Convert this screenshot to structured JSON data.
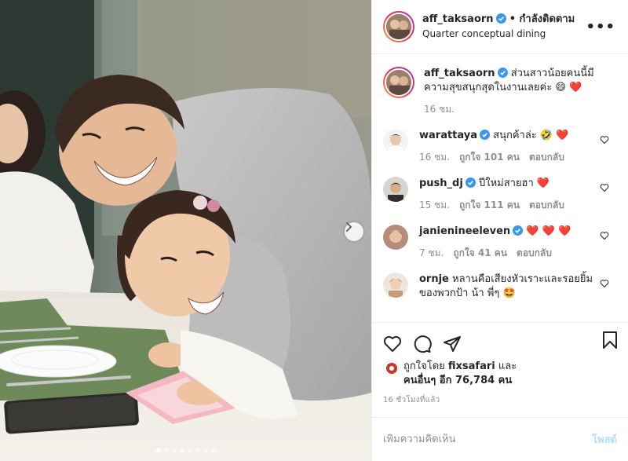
{
  "header": {
    "username": "aff_taksaorn",
    "follow_status": "• กำลังติดตาม",
    "location": "Quarter conceptual dining",
    "more_label": "•••"
  },
  "caption": {
    "username": "aff_taksaorn",
    "text": "ส่วนสาวน้อยคนนี้มีความสุขสนุกสุดในงานเลยค่ะ 😄 ❤️",
    "time": "16 ชม."
  },
  "comments": [
    {
      "username": "warattaya",
      "verified": true,
      "text": "สนุกค้าล่ะ 🤣 ❤️",
      "time": "16 ชม.",
      "likes": "ถูกใจ 101 คน",
      "reply": "ตอบกลับ"
    },
    {
      "username": "push_dj",
      "verified": true,
      "text": "ปีใหม่สายฮา ❤️",
      "time": "15 ชม.",
      "likes": "ถูกใจ 111 คน",
      "reply": "ตอบกลับ"
    },
    {
      "username": "janienineeleven",
      "verified": true,
      "text": "❤️ ❤️ ❤️",
      "time": "7 ชม.",
      "likes": "ถูกใจ 41 คน",
      "reply": "ตอบกลับ"
    },
    {
      "username": "ornje",
      "verified": false,
      "text": "หลานคือเสียงหัวเราะและรอยยิ้มของพวกป้า น้า พี่ๆ 🤩",
      "time": "",
      "likes": "",
      "reply": ""
    }
  ],
  "likes": {
    "prefix": "ถูกใจโดย",
    "by_user": "fixsafari",
    "and": "และ",
    "others": "คนอื่นๆ อีก 76,784 คน"
  },
  "timestamp": "16 ชั่วโมงที่แล้ว",
  "add_comment": {
    "placeholder": "เพิ่มความคิดเห็น",
    "post_label": "โพสต์"
  },
  "carousel": {
    "total": 8,
    "active": 1
  },
  "colors": {
    "verified": "#3897f0",
    "heart": "#ed4956",
    "post_disabled": "#b2dffc",
    "secondary_text": "#8e8e8e"
  }
}
